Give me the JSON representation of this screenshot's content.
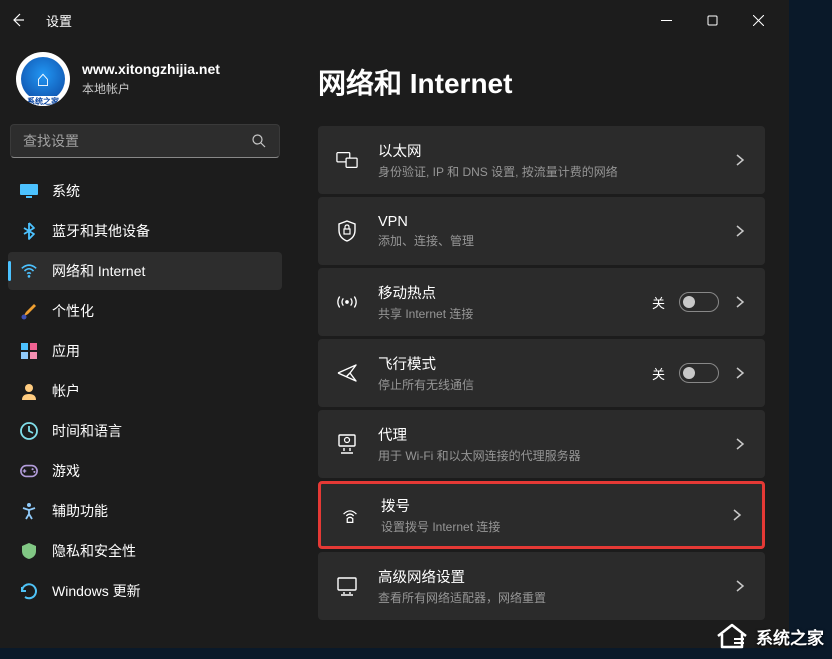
{
  "window": {
    "title": "设置"
  },
  "user": {
    "name": "www.xitongzhijia.net",
    "subtitle": "本地帐户",
    "avatar_tag": "系统之家"
  },
  "search": {
    "placeholder": "查找设置"
  },
  "nav": {
    "items": [
      {
        "label": "系统",
        "icon": "system",
        "color": "#4cc2ff"
      },
      {
        "label": "蓝牙和其他设备",
        "icon": "bluetooth",
        "color": "#4cc2ff"
      },
      {
        "label": "网络和 Internet",
        "icon": "wifi",
        "color": "#4cc2ff",
        "active": true
      },
      {
        "label": "个性化",
        "icon": "brush",
        "color": "#f0a030"
      },
      {
        "label": "应用",
        "icon": "apps",
        "color": "#f06292"
      },
      {
        "label": "帐户",
        "icon": "account",
        "color": "#ffcc80"
      },
      {
        "label": "时间和语言",
        "icon": "time",
        "color": "#80deea"
      },
      {
        "label": "游戏",
        "icon": "game",
        "color": "#b39ddb"
      },
      {
        "label": "辅助功能",
        "icon": "accessibility",
        "color": "#90caf9"
      },
      {
        "label": "隐私和安全性",
        "icon": "privacy",
        "color": "#81c784"
      },
      {
        "label": "Windows 更新",
        "icon": "update",
        "color": "#4fc3f7"
      }
    ]
  },
  "page": {
    "title": "网络和 Internet"
  },
  "cards": [
    {
      "id": "ethernet",
      "title": "以太网",
      "desc": "身份验证, IP 和 DNS 设置, 按流量计费的网络",
      "toggle": false
    },
    {
      "id": "vpn",
      "title": "VPN",
      "desc": "添加、连接、管理",
      "toggle": false
    },
    {
      "id": "hotspot",
      "title": "移动热点",
      "desc": "共享 Internet 连接",
      "toggle": true,
      "toggle_state": "off",
      "toggle_label": "关"
    },
    {
      "id": "airplane",
      "title": "飞行模式",
      "desc": "停止所有无线通信",
      "toggle": true,
      "toggle_state": "off",
      "toggle_label": "关"
    },
    {
      "id": "proxy",
      "title": "代理",
      "desc": "用于 Wi-Fi 和以太网连接的代理服务器",
      "toggle": false
    },
    {
      "id": "dialup",
      "title": "拨号",
      "desc": "设置拨号 Internet 连接",
      "toggle": false,
      "highlighted": true
    },
    {
      "id": "advanced",
      "title": "高级网络设置",
      "desc": "查看所有网络适配器，网络重置",
      "toggle": false
    }
  ],
  "watermark": {
    "text": "系统之家"
  },
  "colors": {
    "bg": "#1c1c1c",
    "card": "#2b2b2b",
    "accent": "#4cc2ff",
    "highlight_border": "#e53935"
  }
}
